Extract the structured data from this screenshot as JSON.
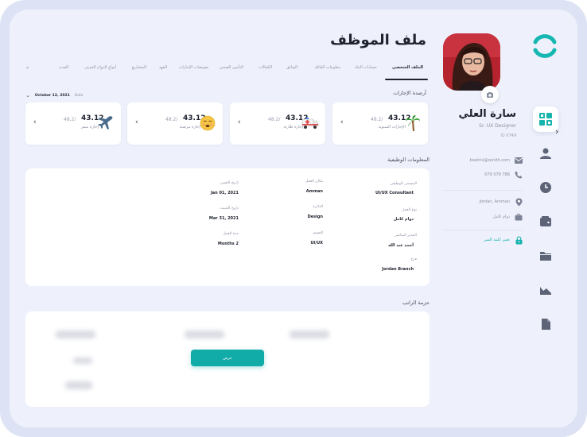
{
  "colors": {
    "accent": "#14b3ae",
    "text": "#1f2330",
    "muted": "#8d93a5",
    "bg": "#eef1fb"
  },
  "page": {
    "title": "ملف الموظف"
  },
  "tabs": {
    "items": [
      {
        "label": "الملف الشخصي",
        "active": true
      },
      {
        "label": "حسابات البنك"
      },
      {
        "label": "معلومات العائلة"
      },
      {
        "label": "الوثائق"
      },
      {
        "label": "الكفالات"
      },
      {
        "label": "التأمين الصحي"
      },
      {
        "label": "تعويضات الإجازات"
      },
      {
        "label": "العهد"
      },
      {
        "label": "المشاريع"
      },
      {
        "label": "أنواع الدوام الجزئي"
      },
      {
        "label": "العديد"
      }
    ],
    "more_icon": "chevron-down-icon"
  },
  "profile": {
    "name": "سارة العلي",
    "role": "Sr. UX Designer",
    "id": "ID 0749",
    "email": "beatrix@zenith.com",
    "phone": "079 079 786",
    "location": "Jordan, Amman",
    "work_type": "دوام كامل",
    "change_password": "تغيير كلمة السر",
    "icons": [
      "camera-icon",
      "mail-icon",
      "phone-icon",
      "location-pin-icon",
      "briefcase-icon",
      "lock-icon"
    ]
  },
  "leave_balances": {
    "title": "أرصدة الإجازات",
    "date": "October 12, 2021",
    "date_label": "Date",
    "cards": [
      {
        "name": "الإجازات السنوية",
        "value": "43.12",
        "total": "48.2/",
        "icon": "palm-tree-icon"
      },
      {
        "name": "إجازة طارئة",
        "value": "43.12",
        "total": "48.2/",
        "icon": "ambulance-icon"
      },
      {
        "name": "إجازة مرضية",
        "value": "43.12",
        "total": "48.2/",
        "icon": "sick-face-icon"
      },
      {
        "name": "إجازة سفر",
        "value": "43.12",
        "total": "48.2/",
        "icon": "airplane-icon"
      }
    ]
  },
  "job_info": {
    "title": "المعلومات الوظيفية",
    "fields": {
      "job_title": {
        "label": "المسمى الوظيفي",
        "value": "UI/UX Consultant"
      },
      "work_place": {
        "label": "مكان العمل",
        "value": "Amman"
      },
      "hire_date": {
        "label": "تاريخ التعيين",
        "value": "Jan 01, 2021"
      },
      "work_type": {
        "label": "نوع العمل",
        "value": "دوام كامل"
      },
      "department": {
        "label": "الدائرة",
        "value": "Design"
      },
      "confirm_date": {
        "label": "تاريخ التثبيت",
        "value": "Mar 31, 2021"
      },
      "manager": {
        "label": "المدير المباشر",
        "value": "أحمد عبد الله"
      },
      "section": {
        "label": "القسم",
        "value": "UI/UX"
      },
      "duration": {
        "label": "مدة العمل",
        "value": "2 Months"
      },
      "branch": {
        "label": "فرع",
        "value": "Jordan Branch"
      }
    }
  },
  "salary": {
    "title": "حزمة الراتب",
    "view_button": "عرض"
  },
  "nav": {
    "items": [
      "grid-icon",
      "user-icon",
      "clock-icon",
      "wallet-icon",
      "folder-icon",
      "chart-icon",
      "document-icon"
    ],
    "active": 0
  }
}
